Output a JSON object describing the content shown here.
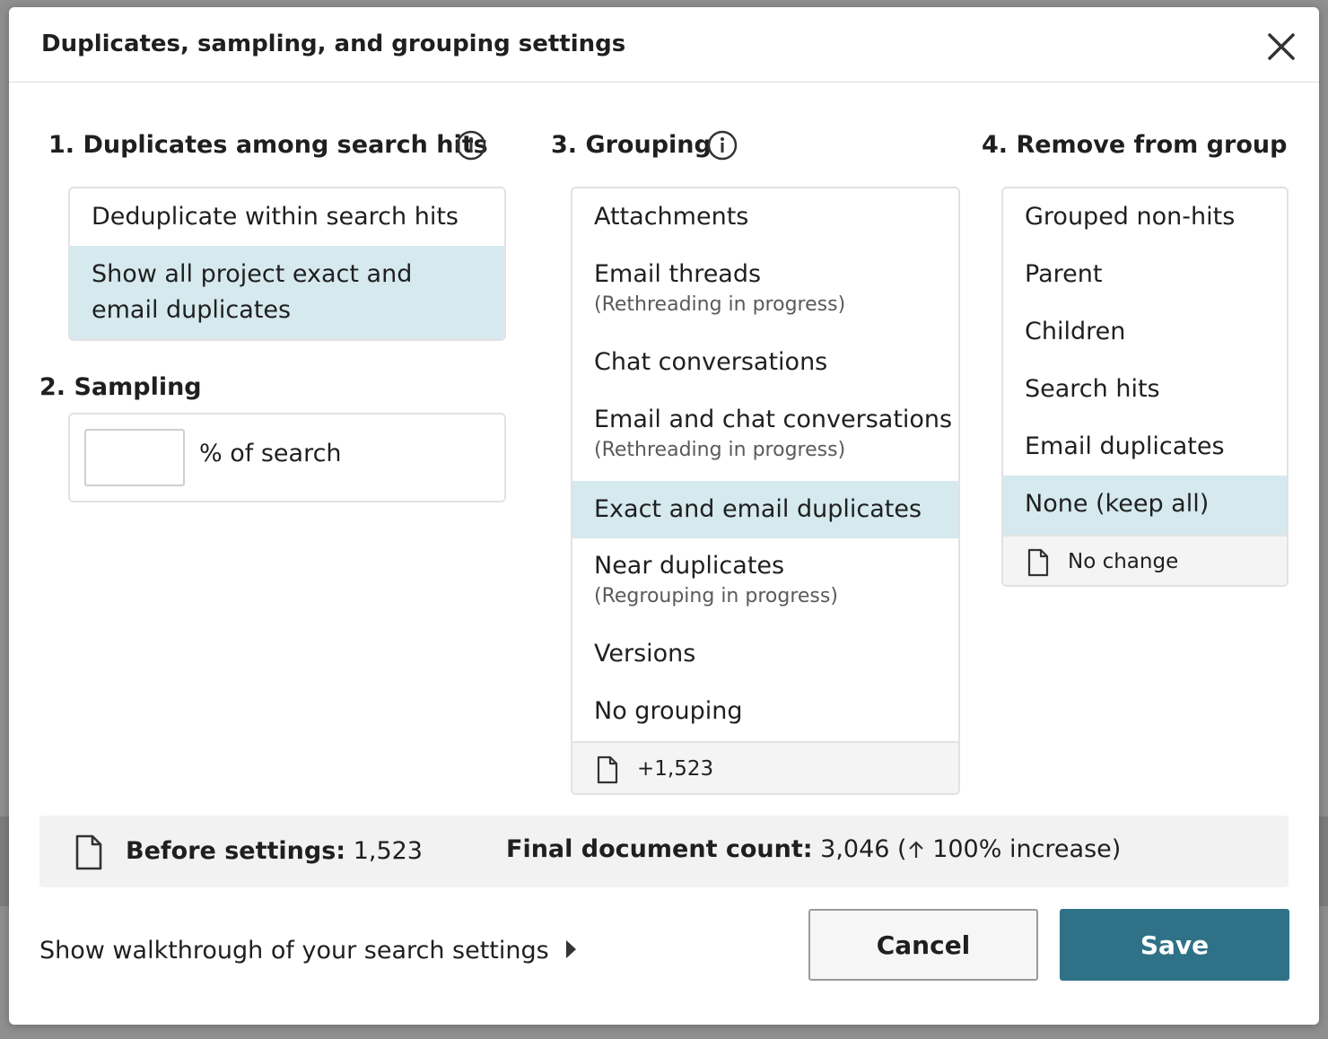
{
  "dialog": {
    "title": "Duplicates, sampling, and grouping settings",
    "close_icon": "close-icon"
  },
  "duplicates": {
    "heading": "1. Duplicates among search hits",
    "options": [
      {
        "label": "Deduplicate within search hits",
        "selected": false
      },
      {
        "label": "Show all project exact and email duplicates",
        "selected": true
      }
    ]
  },
  "sampling": {
    "heading": "2. Sampling",
    "value": "",
    "suffix": "% of search"
  },
  "grouping": {
    "heading": "3. Grouping",
    "options": [
      {
        "label": "Attachments",
        "sub": "",
        "selected": false
      },
      {
        "label": "Email threads",
        "sub": "(Rethreading in progress)",
        "selected": false
      },
      {
        "label": "Chat conversations",
        "sub": "",
        "selected": false
      },
      {
        "label": "Email and chat conversations",
        "sub": "(Rethreading in progress)",
        "selected": false
      },
      {
        "label": "Exact and email duplicates",
        "sub": "",
        "selected": true
      },
      {
        "label": "Near duplicates",
        "sub": "(Regrouping in progress)",
        "selected": false
      },
      {
        "label": "Versions",
        "sub": "",
        "selected": false
      },
      {
        "label": "No grouping",
        "sub": "",
        "selected": false
      }
    ],
    "footer": "+1,523"
  },
  "remove": {
    "heading": "4. Remove from group",
    "options": [
      {
        "label": "Grouped non-hits",
        "selected": false
      },
      {
        "label": "Parent",
        "selected": false
      },
      {
        "label": "Children",
        "selected": false
      },
      {
        "label": "Search hits",
        "selected": false
      },
      {
        "label": "Email duplicates",
        "selected": false
      },
      {
        "label": "None (keep all)",
        "selected": true
      }
    ],
    "footer": "No change"
  },
  "summary": {
    "before_label": "Before settings:",
    "before_value": "1,523",
    "final_label": "Final document count:",
    "final_value": "3,046 (",
    "final_change": "100% increase)"
  },
  "footer": {
    "walkthrough": "Show walkthrough of your search settings",
    "cancel": "Cancel",
    "save": "Save"
  },
  "colors": {
    "selected_bg": "#d5e9ef",
    "primary": "#2f7288"
  }
}
